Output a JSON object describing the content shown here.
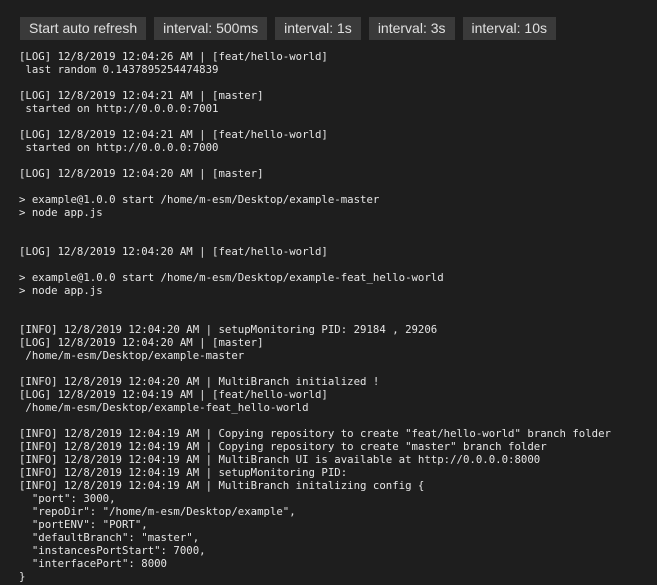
{
  "toolbar": {
    "buttons": [
      "Start auto refresh",
      "interval: 500ms",
      "interval: 1s",
      "interval: 3s",
      "interval: 10s"
    ]
  },
  "log": {
    "lines": [
      "[LOG] 12/8/2019 12:04:26 AM | [feat/hello-world]",
      " last random 0.1437895254474839",
      "",
      "[LOG] 12/8/2019 12:04:21 AM | [master]",
      " started on http://0.0.0.0:7001",
      "",
      "[LOG] 12/8/2019 12:04:21 AM | [feat/hello-world]",
      " started on http://0.0.0.0:7000",
      "",
      "[LOG] 12/8/2019 12:04:20 AM | [master]",
      "",
      "> example@1.0.0 start /home/m-esm/Desktop/example-master",
      "> node app.js",
      "",
      "",
      "[LOG] 12/8/2019 12:04:20 AM | [feat/hello-world]",
      "",
      "> example@1.0.0 start /home/m-esm/Desktop/example-feat_hello-world",
      "> node app.js",
      "",
      "",
      "[INFO] 12/8/2019 12:04:20 AM | setupMonitoring PID: 29184 , 29206",
      "[LOG] 12/8/2019 12:04:20 AM | [master]",
      " /home/m-esm/Desktop/example-master",
      "",
      "[INFO] 12/8/2019 12:04:20 AM | MultiBranch initialized !",
      "[LOG] 12/8/2019 12:04:19 AM | [feat/hello-world]",
      " /home/m-esm/Desktop/example-feat_hello-world",
      "",
      "[INFO] 12/8/2019 12:04:19 AM | Copying repository to create \"feat/hello-world\" branch folder",
      "[INFO] 12/8/2019 12:04:19 AM | Copying repository to create \"master\" branch folder",
      "[INFO] 12/8/2019 12:04:19 AM | MultiBranch UI is available at http://0.0.0.0:8000",
      "[INFO] 12/8/2019 12:04:19 AM | setupMonitoring PID:",
      "[INFO] 12/8/2019 12:04:19 AM | MultiBranch initalizing config {",
      "  \"port\": 3000,",
      "  \"repoDir\": \"/home/m-esm/Desktop/example\",",
      "  \"portENV\": \"PORT\",",
      "  \"defaultBranch\": \"master\",",
      "  \"instancesPortStart\": 7000,",
      "  \"interfacePort\": 8000",
      "}"
    ]
  }
}
